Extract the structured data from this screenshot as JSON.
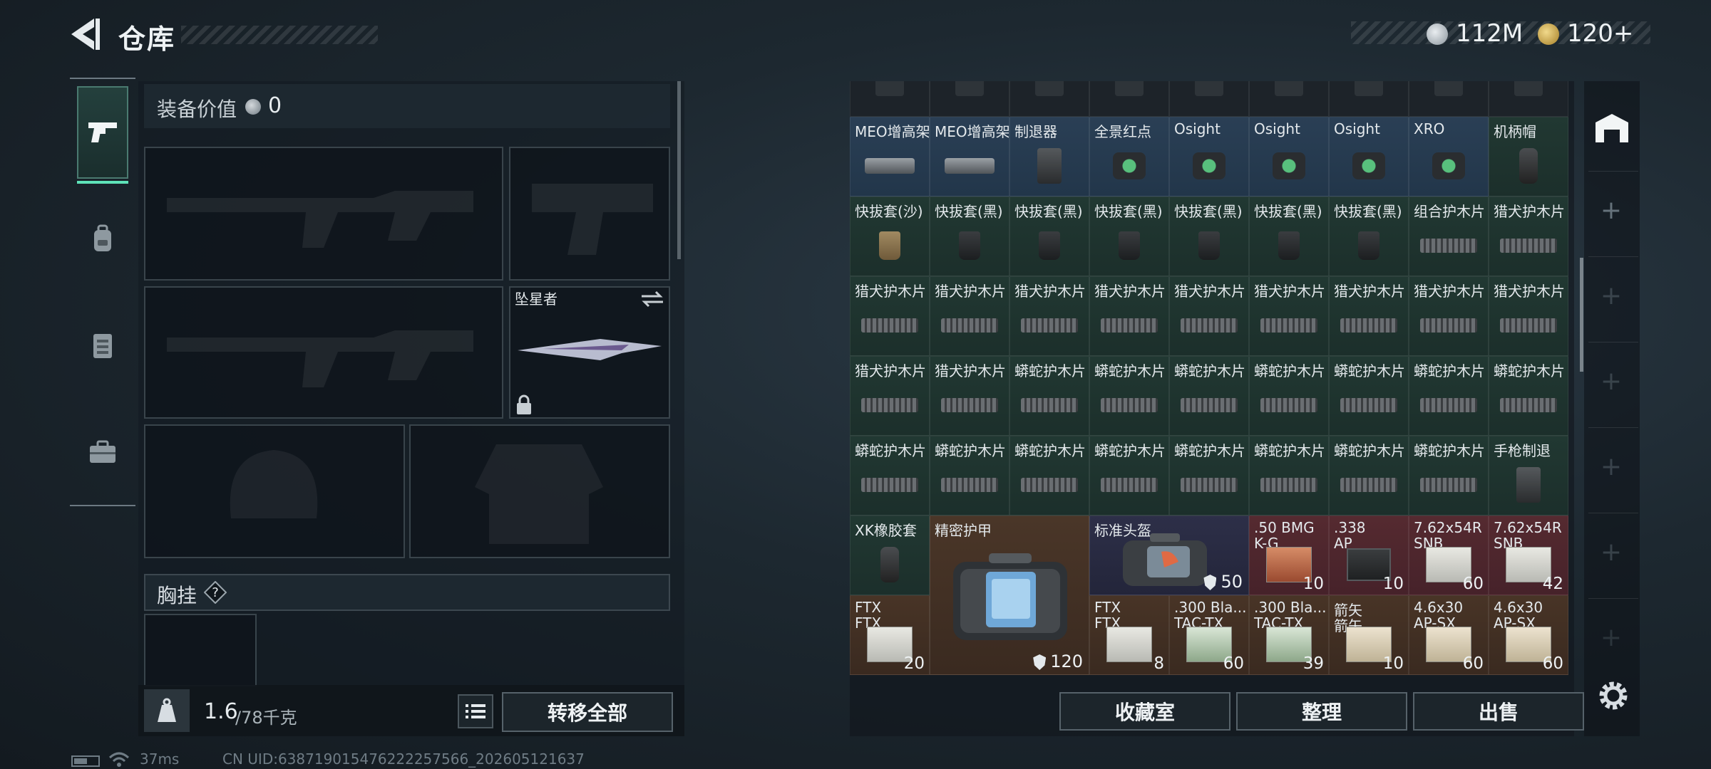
{
  "header": {
    "title": "仓库"
  },
  "currency": [
    {
      "value": "112M",
      "icon": "silver-coin-icon"
    },
    {
      "value": "120+",
      "icon": "gold-coin-icon"
    }
  ],
  "equipment": {
    "value_label": "装备价值",
    "value": "0",
    "melee_name": "坠星者",
    "chest_label": "胸挂",
    "chest_help": "?",
    "weight_current": "1.6",
    "weight_max": "/78千克",
    "transfer_all": "转移全部"
  },
  "stash_rows": [
    [
      {
        "name": "MEO增高架",
        "icon": "scope"
      },
      {
        "name": "MEO增高架",
        "icon": "scope"
      },
      {
        "name": "制退器",
        "icon": "muzzle"
      },
      {
        "name": "全景红点",
        "icon": "sight"
      },
      {
        "name": "Osight",
        "icon": "sight"
      },
      {
        "name": "Osight",
        "icon": "sight"
      },
      {
        "name": "Osight",
        "icon": "sight"
      },
      {
        "name": "XRO",
        "icon": "sight"
      },
      {
        "name": "机柄帽",
        "icon": "grip"
      }
    ],
    [
      {
        "name": "快拔套(沙)",
        "icon": "holster-sand"
      },
      {
        "name": "快拔套(黑)",
        "icon": "holster"
      },
      {
        "name": "快拔套(黑)",
        "icon": "holster"
      },
      {
        "name": "快拔套(黑)",
        "icon": "holster"
      },
      {
        "name": "快拔套(黑)",
        "icon": "holster"
      },
      {
        "name": "快拔套(黑)",
        "icon": "holster"
      },
      {
        "name": "快拔套(黑)",
        "icon": "holster"
      },
      {
        "name": "组合护木片",
        "icon": "rail"
      },
      {
        "name": "猎犬护木片",
        "icon": "rail"
      }
    ],
    [
      {
        "name": "猎犬护木片",
        "icon": "rail"
      },
      {
        "name": "猎犬护木片",
        "icon": "rail"
      },
      {
        "name": "猎犬护木片",
        "icon": "rail"
      },
      {
        "name": "猎犬护木片",
        "icon": "rail"
      },
      {
        "name": "猎犬护木片",
        "icon": "rail"
      },
      {
        "name": "猎犬护木片",
        "icon": "rail"
      },
      {
        "name": "猎犬护木片",
        "icon": "rail"
      },
      {
        "name": "猎犬护木片",
        "icon": "rail"
      },
      {
        "name": "猎犬护木片",
        "icon": "rail"
      }
    ],
    [
      {
        "name": "猎犬护木片",
        "icon": "rail"
      },
      {
        "name": "猎犬护木片",
        "icon": "rail"
      },
      {
        "name": "蟒蛇护木片",
        "icon": "rail"
      },
      {
        "name": "蟒蛇护木片",
        "icon": "rail"
      },
      {
        "name": "蟒蛇护木片",
        "icon": "rail"
      },
      {
        "name": "蟒蛇护木片",
        "icon": "rail"
      },
      {
        "name": "蟒蛇护木片",
        "icon": "rail"
      },
      {
        "name": "蟒蛇护木片",
        "icon": "rail"
      },
      {
        "name": "蟒蛇护木片",
        "icon": "rail"
      }
    ],
    [
      {
        "name": "蟒蛇护木片",
        "icon": "rail"
      },
      {
        "name": "蟒蛇护木片",
        "icon": "rail"
      },
      {
        "name": "蟒蛇护木片",
        "icon": "rail"
      },
      {
        "name": "蟒蛇护木片",
        "icon": "rail"
      },
      {
        "name": "蟒蛇护木片",
        "icon": "rail"
      },
      {
        "name": "蟒蛇护木片",
        "icon": "rail"
      },
      {
        "name": "蟒蛇护木片",
        "icon": "rail"
      },
      {
        "name": "蟒蛇护木片",
        "icon": "rail"
      },
      {
        "name": "手枪制退",
        "icon": "muzzle"
      }
    ]
  ],
  "stash_bottom": {
    "xk": {
      "name": "XK橡胶套",
      "icon": "grip"
    },
    "armor": {
      "name": "精密护甲",
      "count": "120",
      "icon": "armor"
    },
    "helmet": {
      "name": "标准头盔",
      "count": "50",
      "icon": "helmet"
    },
    "row6": [
      {
        "name": ".50 BMG",
        "name2": "K-G",
        "count": "10",
        "color": "red",
        "icon": "ammo-red"
      },
      {
        "name": ".338",
        "name2": "AP",
        "count": "10",
        "color": "red",
        "icon": "ammo-can"
      },
      {
        "name": "7.62x54R",
        "name2": "SNB",
        "count": "60",
        "color": "red",
        "icon": "ammo"
      },
      {
        "name": "7.62x54R",
        "name2": "SNB",
        "count": "42",
        "color": "red",
        "icon": "ammo"
      }
    ],
    "row7_left": {
      "name": "FTX",
      "name2": "FTX",
      "count": "20",
      "icon": "ammo"
    },
    "row7": [
      {
        "name": "FTX",
        "name2": "FTX",
        "count": "8",
        "color": "brown",
        "icon": "ammo"
      },
      {
        "name": ".300 Bla...",
        "name2": "TAC-TX",
        "count": "60",
        "color": "brown",
        "icon": "ammo-green"
      },
      {
        "name": ".300 Bla...",
        "name2": "TAC-TX",
        "count": "39",
        "color": "brown",
        "icon": "ammo-green"
      },
      {
        "name": "箭矢",
        "name2": "箭矢",
        "count": "10",
        "color": "brown",
        "icon": "ammo-tan"
      },
      {
        "name": "4.6x30",
        "name2": "AP-SX",
        "count": "60",
        "color": "brown",
        "icon": "ammo-tan"
      },
      {
        "name": "4.6x30",
        "name2": "AP-SX",
        "count": "60",
        "color": "brown",
        "icon": "ammo-tan"
      }
    ]
  },
  "actions": {
    "favorites": "收藏室",
    "sort": "整理",
    "sell": "出售"
  },
  "status": {
    "ping": "37ms",
    "uid": "CN UID:638719015476222257566_202605121637"
  },
  "colors": {
    "accent": "#5ee2b8",
    "bg": "#1d2830"
  }
}
